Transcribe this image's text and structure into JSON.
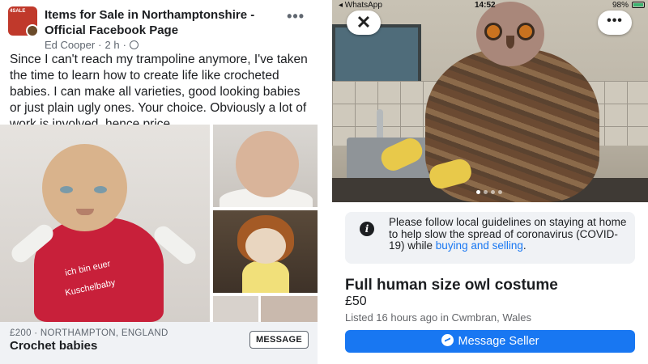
{
  "post": {
    "group_title": "Items for Sale in Northamptonshire - Official Facebook Page",
    "author": "Ed Cooper",
    "time": "2 h",
    "more_icon": "more-horizontal-icon",
    "body": "Since I can't reach my trampoline anymore, I've taken the time to learn how to create life like crocheted babies. I can make all varieties, good looking babies or just plain ugly ones. Your choice. Obviously a lot of work is involved, hence price.",
    "shirt_text_1": "ich bin euer",
    "shirt_text_2": "Kuschelbaby",
    "listing": {
      "price_location": "£200 · NORTHAMPTON, ENGLAND",
      "title": "Crochet babies",
      "message_label": "MESSAGE"
    }
  },
  "marketplace": {
    "status_bar": {
      "app": "◂ WhatsApp",
      "time": "14:52",
      "battery": "98%"
    },
    "close_icon": "close-icon",
    "more_icon": "more-horizontal-icon",
    "notice": {
      "text": "Please follow local guidelines on staying at home to help slow the spread of coronavirus (COVID-19) while",
      "link": "buying and selling",
      "end": "."
    },
    "title": "Full human size owl costume",
    "price": "£50",
    "listed": "Listed 16 hours ago in Cwmbran, Wales",
    "message_seller": "Message Seller"
  },
  "colors": {
    "facebook_blue": "#1877f2",
    "text": "#1c1e21",
    "muted": "#606770"
  }
}
